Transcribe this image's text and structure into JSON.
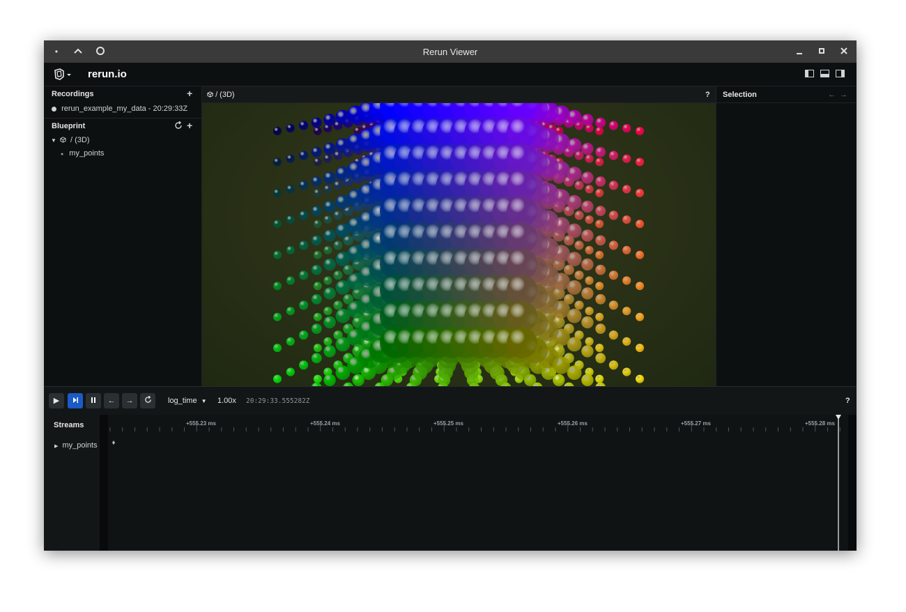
{
  "window": {
    "title": "Rerun Viewer"
  },
  "appbar": {
    "brand": "rerun.io"
  },
  "recordings": {
    "title": "Recordings",
    "items": [
      {
        "label": "rerun_example_my_data - 20:29:33Z"
      }
    ]
  },
  "blueprint": {
    "title": "Blueprint",
    "tree": {
      "root": "/ (3D)",
      "child": "my_points"
    }
  },
  "view": {
    "title": "/ (3D)",
    "help": "?"
  },
  "selection": {
    "title": "Selection"
  },
  "timeline": {
    "timeline_name": "log_time",
    "speed": "1.00x",
    "current_time": "20:29:33.555282Z",
    "help": "?",
    "streams_title": "Streams",
    "stream_items": [
      {
        "label": "my_points"
      }
    ],
    "tick_labels": [
      "+555.23 ms",
      "+555.24 ms",
      "+555.25 ms",
      "+555.26 ms",
      "+555.27 ms",
      "+555.28 ms"
    ]
  },
  "colors": {
    "accent": "#1b5ac7",
    "background": "#0d1011",
    "panel": "#121617"
  },
  "icons": {
    "window_controls": [
      "dot-icon",
      "chevron-up-icon",
      "circle-icon",
      "minimize-icon",
      "maximize-icon",
      "close-icon"
    ],
    "playback": [
      "play-icon",
      "step-play-icon",
      "pause-icon",
      "arrow-left-icon",
      "arrow-right-icon",
      "loop-icon"
    ]
  }
}
